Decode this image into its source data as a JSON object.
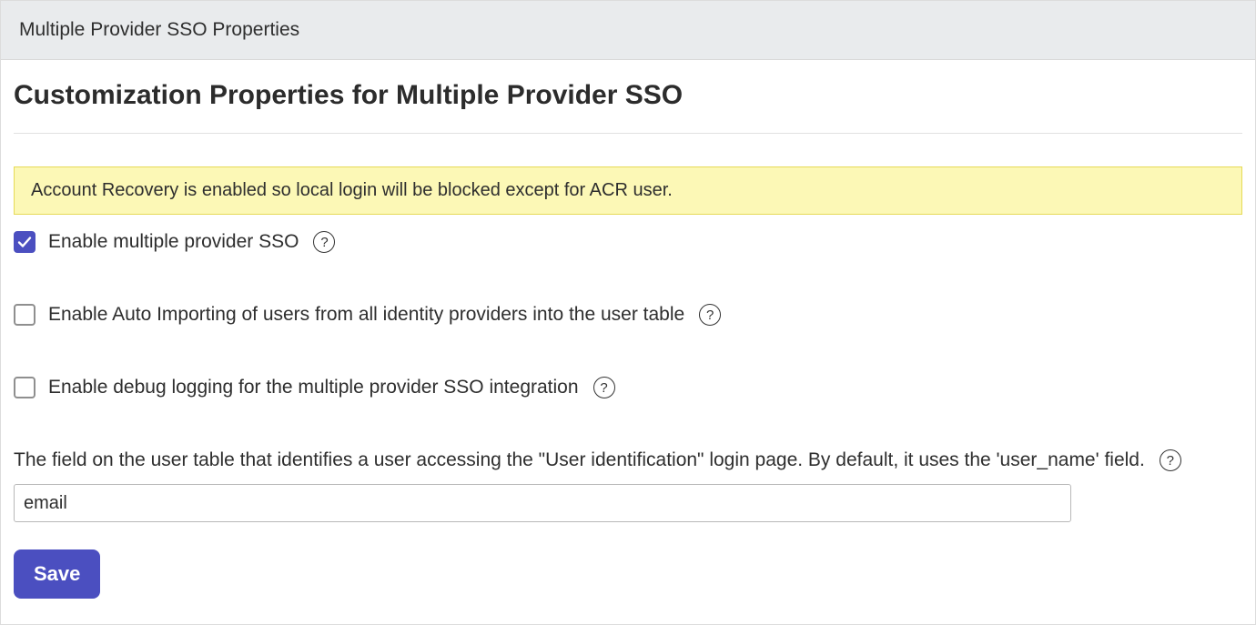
{
  "titlebar": {
    "title": "Multiple Provider SSO Properties"
  },
  "section": {
    "heading": "Customization Properties for Multiple Provider SSO"
  },
  "banner": {
    "text": "Account Recovery is enabled so local login will be blocked except for ACR user."
  },
  "fields": {
    "enable_sso": {
      "label": "Enable multiple provider SSO",
      "checked": true,
      "help_glyph": "?"
    },
    "enable_auto_import": {
      "label": "Enable Auto Importing of users from all identity providers into the user table",
      "checked": false,
      "help_glyph": "?"
    },
    "enable_debug": {
      "label": "Enable debug logging for the multiple provider SSO integration",
      "checked": false,
      "help_glyph": "?"
    },
    "user_id_field": {
      "label": "The field on the user table that identifies a user accessing the \"User identification\" login page. By default, it uses the 'user_name' field.",
      "value": "email",
      "help_glyph": "?"
    }
  },
  "buttons": {
    "save": "Save"
  }
}
